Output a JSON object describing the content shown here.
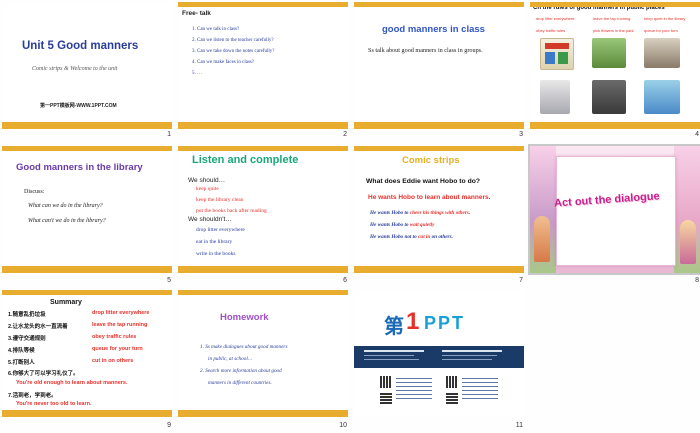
{
  "slides": [
    {
      "number": "1",
      "title": "Unit 5  Good manners",
      "subtitle": "Comic strips & Welcome to the unit",
      "footer": "第一PPT模板网-WWW.1PPT.COM"
    },
    {
      "number": "2",
      "heading": "Free- talk",
      "items": [
        "1. Can we talk in class?",
        "2. Can we listen to the teacher carefully?",
        "3. Can we take down the notes carefully?",
        "4. Can we make faces in class?",
        "5. …"
      ]
    },
    {
      "number": "3",
      "title": "good manners in class",
      "body": "Ss talk about good manners in class in groups."
    },
    {
      "number": "4",
      "header": "Ch the rules of good manners in public places",
      "labels_row1": [
        "drop litter everywhere",
        "leave the tap running",
        "keep quiet in the library"
      ],
      "labels_row2": [
        "obey traffic rules",
        "pick flowers in the park",
        "queue for your turn"
      ]
    },
    {
      "number": "5",
      "title": "Good manners in the library",
      "discuss": "Discuss:",
      "q1": "What can we do in the library?",
      "q2": "What can't we do in the library?"
    },
    {
      "number": "6",
      "title": "Listen and complete",
      "should_label": "We should…",
      "should": [
        "keep quite",
        "keep the library clean",
        "put the books back after reading"
      ],
      "shouldnt_label": "We shouldn't…",
      "shouldnt": [
        "drop litter everywhere",
        "eat in the library",
        "write in the books"
      ]
    },
    {
      "number": "7",
      "title": "Comic strips",
      "question": "What does Eddie want Hobo to do?",
      "answer": "He wants Hobo to learn about manners.",
      "lines": [
        {
          "pre": "He wants Hobo to ",
          "hl": "cheer his things with others",
          "post": "."
        },
        {
          "pre": "He wants Hobo to ",
          "hl": "wait quietly",
          "post": ""
        },
        {
          "pre": "He wants Hobo not to ",
          "hl": "cut in",
          "post": " on others."
        }
      ]
    },
    {
      "number": "8",
      "title": "Act out the dialogue"
    },
    {
      "number": "9",
      "title": "Summary",
      "rows": [
        {
          "cn": "1.随意乱扔垃圾",
          "en": "drop litter everywhere"
        },
        {
          "cn": "2.让水龙头的水一直流着",
          "en": "leave the tap running"
        },
        {
          "cn": "3.遵守交通规则",
          "en": "obey  traffic rules"
        },
        {
          "cn": "4.排队等候",
          "en": "queue for your turn"
        },
        {
          "cn": "5.打断别人",
          "en": "cut in on others"
        }
      ],
      "q6": "6.你够大了可以学习礼仪了。",
      "a6": "You're old enough to learn about manners.",
      "q7": "7.活到老，学到老。",
      "a7": "You're never too old to learn."
    },
    {
      "number": "10",
      "title": "Homework",
      "items": [
        "1.  Ss make dialogues about good manners",
        "in public, at school…",
        "2.  Search more information about good",
        "manners in different countries."
      ]
    },
    {
      "number": "11",
      "logo_mark": "第",
      "logo_num": "1",
      "logo_ppt": "PPT"
    }
  ],
  "colors": {
    "accent_bar": "#e8ac2e",
    "title_blue": "#2a3c9c",
    "red": "#e8302a"
  }
}
